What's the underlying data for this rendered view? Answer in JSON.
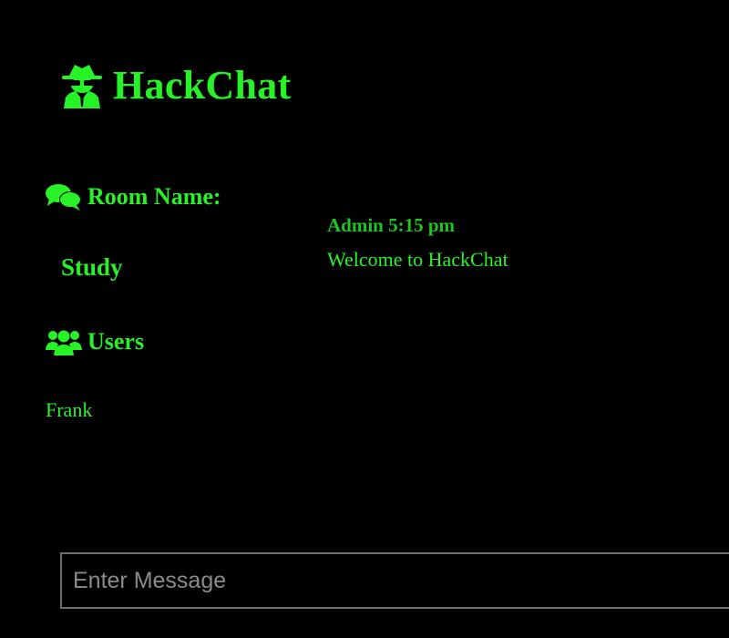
{
  "app": {
    "title": "HackChat",
    "logo_icon": "user-secret-icon",
    "accent_color": "#27f227",
    "background_color": "#000000"
  },
  "sidebar": {
    "room_heading": "Room Name:",
    "room_icon": "comments-icon",
    "room_name": "Study",
    "users_heading": "Users",
    "users_icon": "users-icon",
    "users": [
      "Frank"
    ]
  },
  "messages": [
    {
      "author": "Admin",
      "time": "5:15 pm",
      "meta": "Admin 5:15 pm",
      "text": "Welcome to HackChat"
    }
  ],
  "composer": {
    "placeholder": "Enter Message",
    "value": ""
  }
}
